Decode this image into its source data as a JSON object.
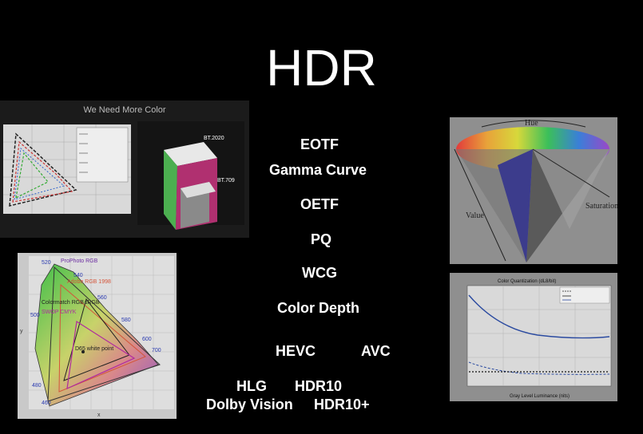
{
  "slide": {
    "title": "HDR"
  },
  "terms": {
    "eotf": "EOTF",
    "gamma": "Gamma Curve",
    "oetf": "OETF",
    "pq": "PQ",
    "wcg": "WCG",
    "depth": "Color Depth",
    "hevc": "HEVC",
    "avc": "AVC",
    "hlg": "HLG",
    "hdr10": "HDR10",
    "dolby": "Dolby Vision",
    "hdr10plus": "HDR10+"
  },
  "panel_top_left": {
    "title": "We Need More Color",
    "bt2020": "BT.2020",
    "bt709": "BT.709"
  },
  "panel_bottom_left": {
    "prophoto": "ProPhoto RGB",
    "adobe": "Adobe RGB 1998",
    "srgb": "sRGB",
    "colormatch": "Colormatch RGB",
    "swop": "SWOP CMYK",
    "d65": "D65 white point",
    "wl_520": "520",
    "wl_540": "540",
    "wl_560": "560",
    "wl_580": "580",
    "wl_600": "600",
    "wl_700": "700",
    "wl_480": "480",
    "wl_460": "460",
    "wl_500": "500",
    "x_axis_label": "x",
    "y_axis_label": "y"
  },
  "panel_top_right": {
    "hue": "Hue",
    "value": "Value",
    "saturation": "Saturation"
  },
  "panel_bottom_right": {
    "chart_title": "Color Quantization (dL8/bit)",
    "x_axis_label": "Gray Level Luminance (nits)"
  },
  "colors": {
    "background": "#000000",
    "text": "#ffffff",
    "panel_gray": "#8f8f8f"
  }
}
